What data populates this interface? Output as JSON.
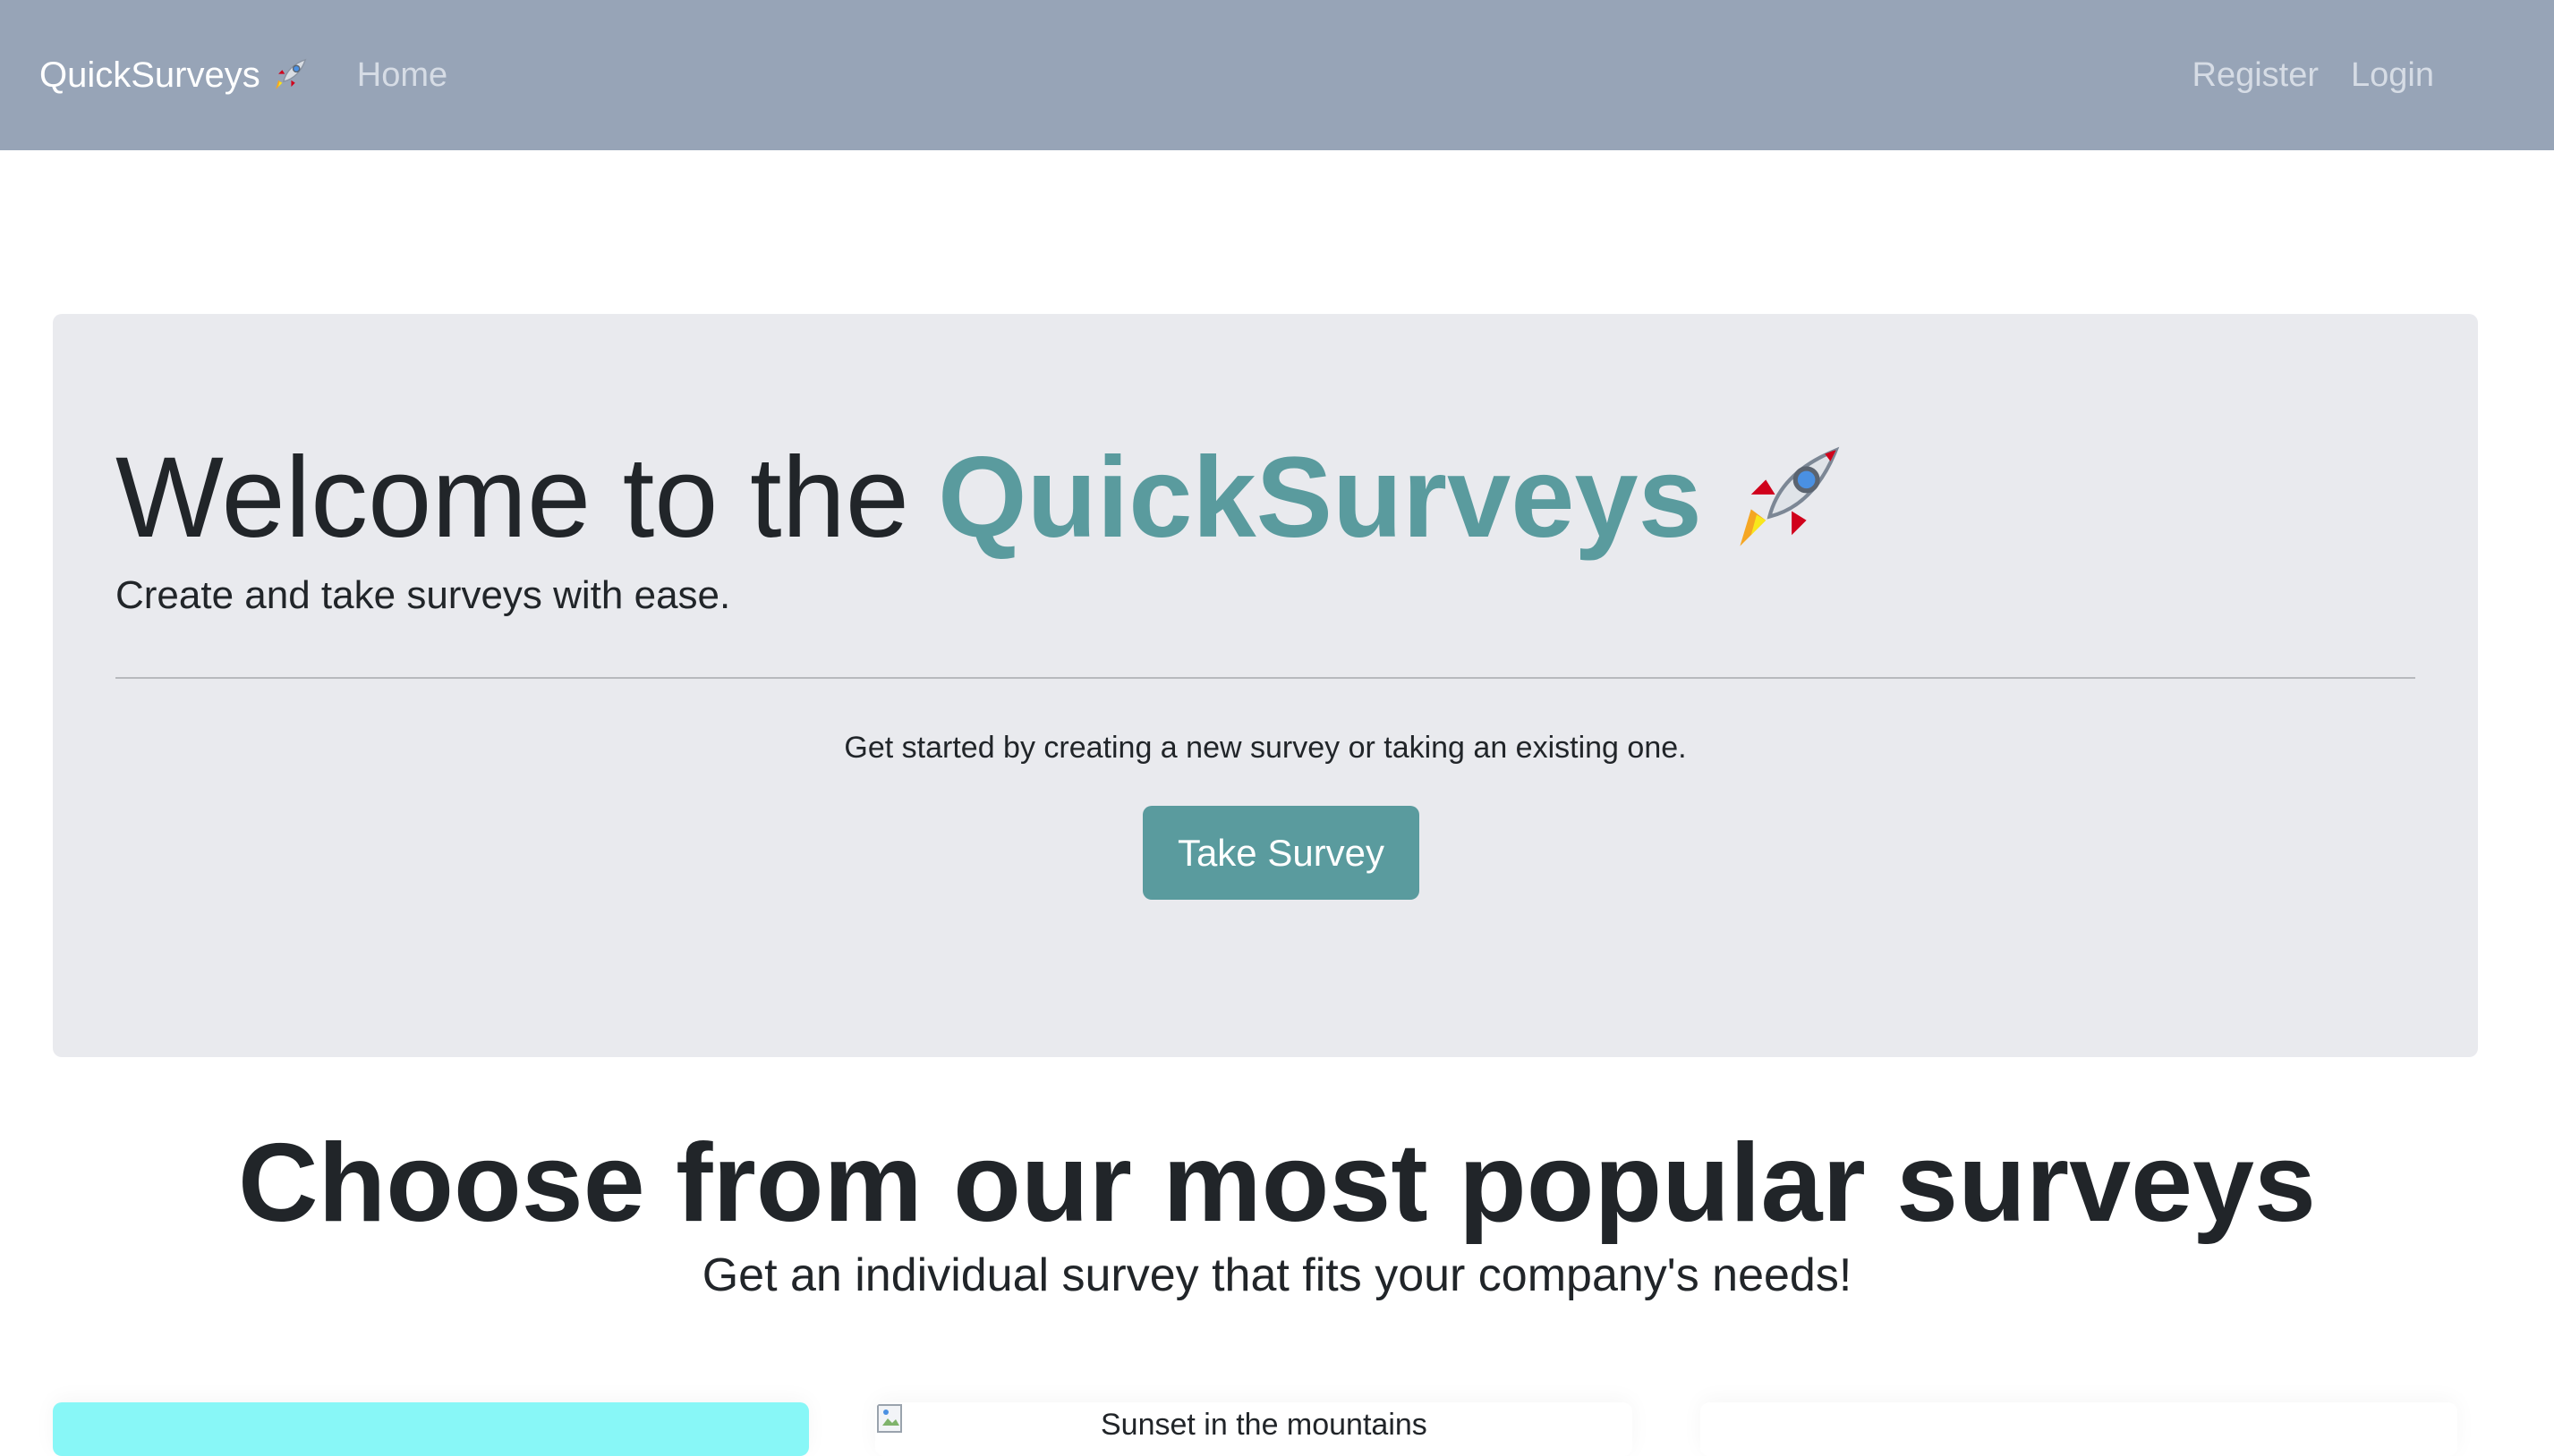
{
  "navbar": {
    "brand": "QuickSurveys",
    "brand_icon": "rocket-icon",
    "links": {
      "home": "Home",
      "register": "Register",
      "login": "Login"
    },
    "bg_color": "#97a4b7"
  },
  "hero": {
    "title_prefix": "Welcome to the",
    "title_brand": "QuickSurveys",
    "title_icon": "rocket-icon",
    "lead": "Create and take surveys with ease.",
    "cta_text": "Get started by creating a new survey or taking an existing one.",
    "button_label": "Take Survey",
    "accent_color": "#5a9b9e"
  },
  "popular": {
    "title": "Choose from our most popular surveys",
    "subtitle": "Get an individual survey that fits your company's needs!"
  },
  "cards": [
    {
      "image_alt": ""
    },
    {
      "image_alt": "Sunset in the mountains",
      "image_icon": "broken-image-icon"
    },
    {
      "image_alt": ""
    }
  ]
}
